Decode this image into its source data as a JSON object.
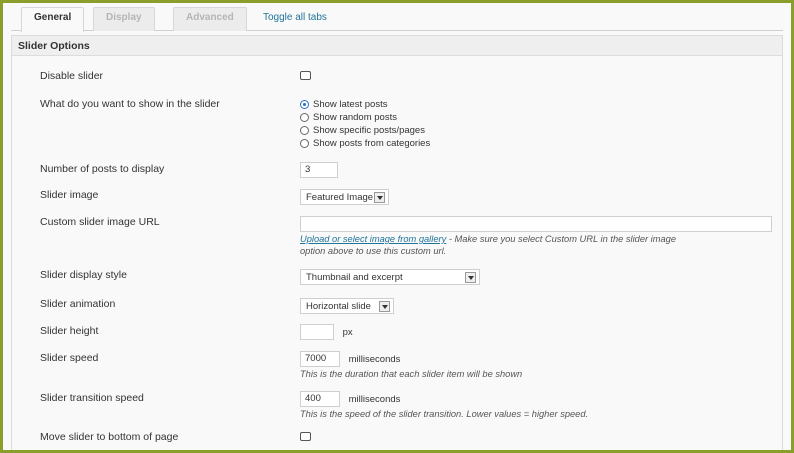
{
  "tabs": [
    {
      "label": "General",
      "active": true
    },
    {
      "label": "Display",
      "active": false
    },
    {
      "label": "Advanced",
      "active": false
    }
  ],
  "toggle_all_tabs": "Toggle all tabs",
  "section_title": "Slider Options",
  "rows": {
    "disable_slider": {
      "label": "Disable slider",
      "checked": false
    },
    "show_in_slider": {
      "label": "What do you want to show in the slider",
      "options": [
        "Show latest posts",
        "Show random posts",
        "Show specific posts/pages",
        "Show posts from categories"
      ],
      "selected": "Show latest posts"
    },
    "num_posts": {
      "label": "Number of posts to display",
      "value": "3"
    },
    "slider_image": {
      "label": "Slider image",
      "value": "Featured Image"
    },
    "custom_url": {
      "label": "Custom slider image URL",
      "value": "",
      "link_text": "Upload or select image from gallery",
      "help_after_link": " - Make sure you select Custom URL in the slider image",
      "help_line2": "option above to use this custom url."
    },
    "display_style": {
      "label": "Slider display style",
      "value": "Thumbnail and excerpt"
    },
    "animation": {
      "label": "Slider animation",
      "value": "Horizontal slide"
    },
    "height": {
      "label": "Slider height",
      "value": "",
      "unit": "px"
    },
    "speed": {
      "label": "Slider speed",
      "value": "7000",
      "unit": "milliseconds",
      "help": "This is the duration that each slider item will be shown"
    },
    "transition_speed": {
      "label": "Slider transition speed",
      "value": "400",
      "unit": "milliseconds",
      "help": "This is the speed of the slider transition. Lower values = higher speed."
    },
    "move_bottom": {
      "label": "Move slider to bottom of page",
      "checked": false
    }
  },
  "colors": {
    "frame_border": "#8a9e2b",
    "link": "#21759b",
    "radio_accent": "#2a6fc9"
  }
}
